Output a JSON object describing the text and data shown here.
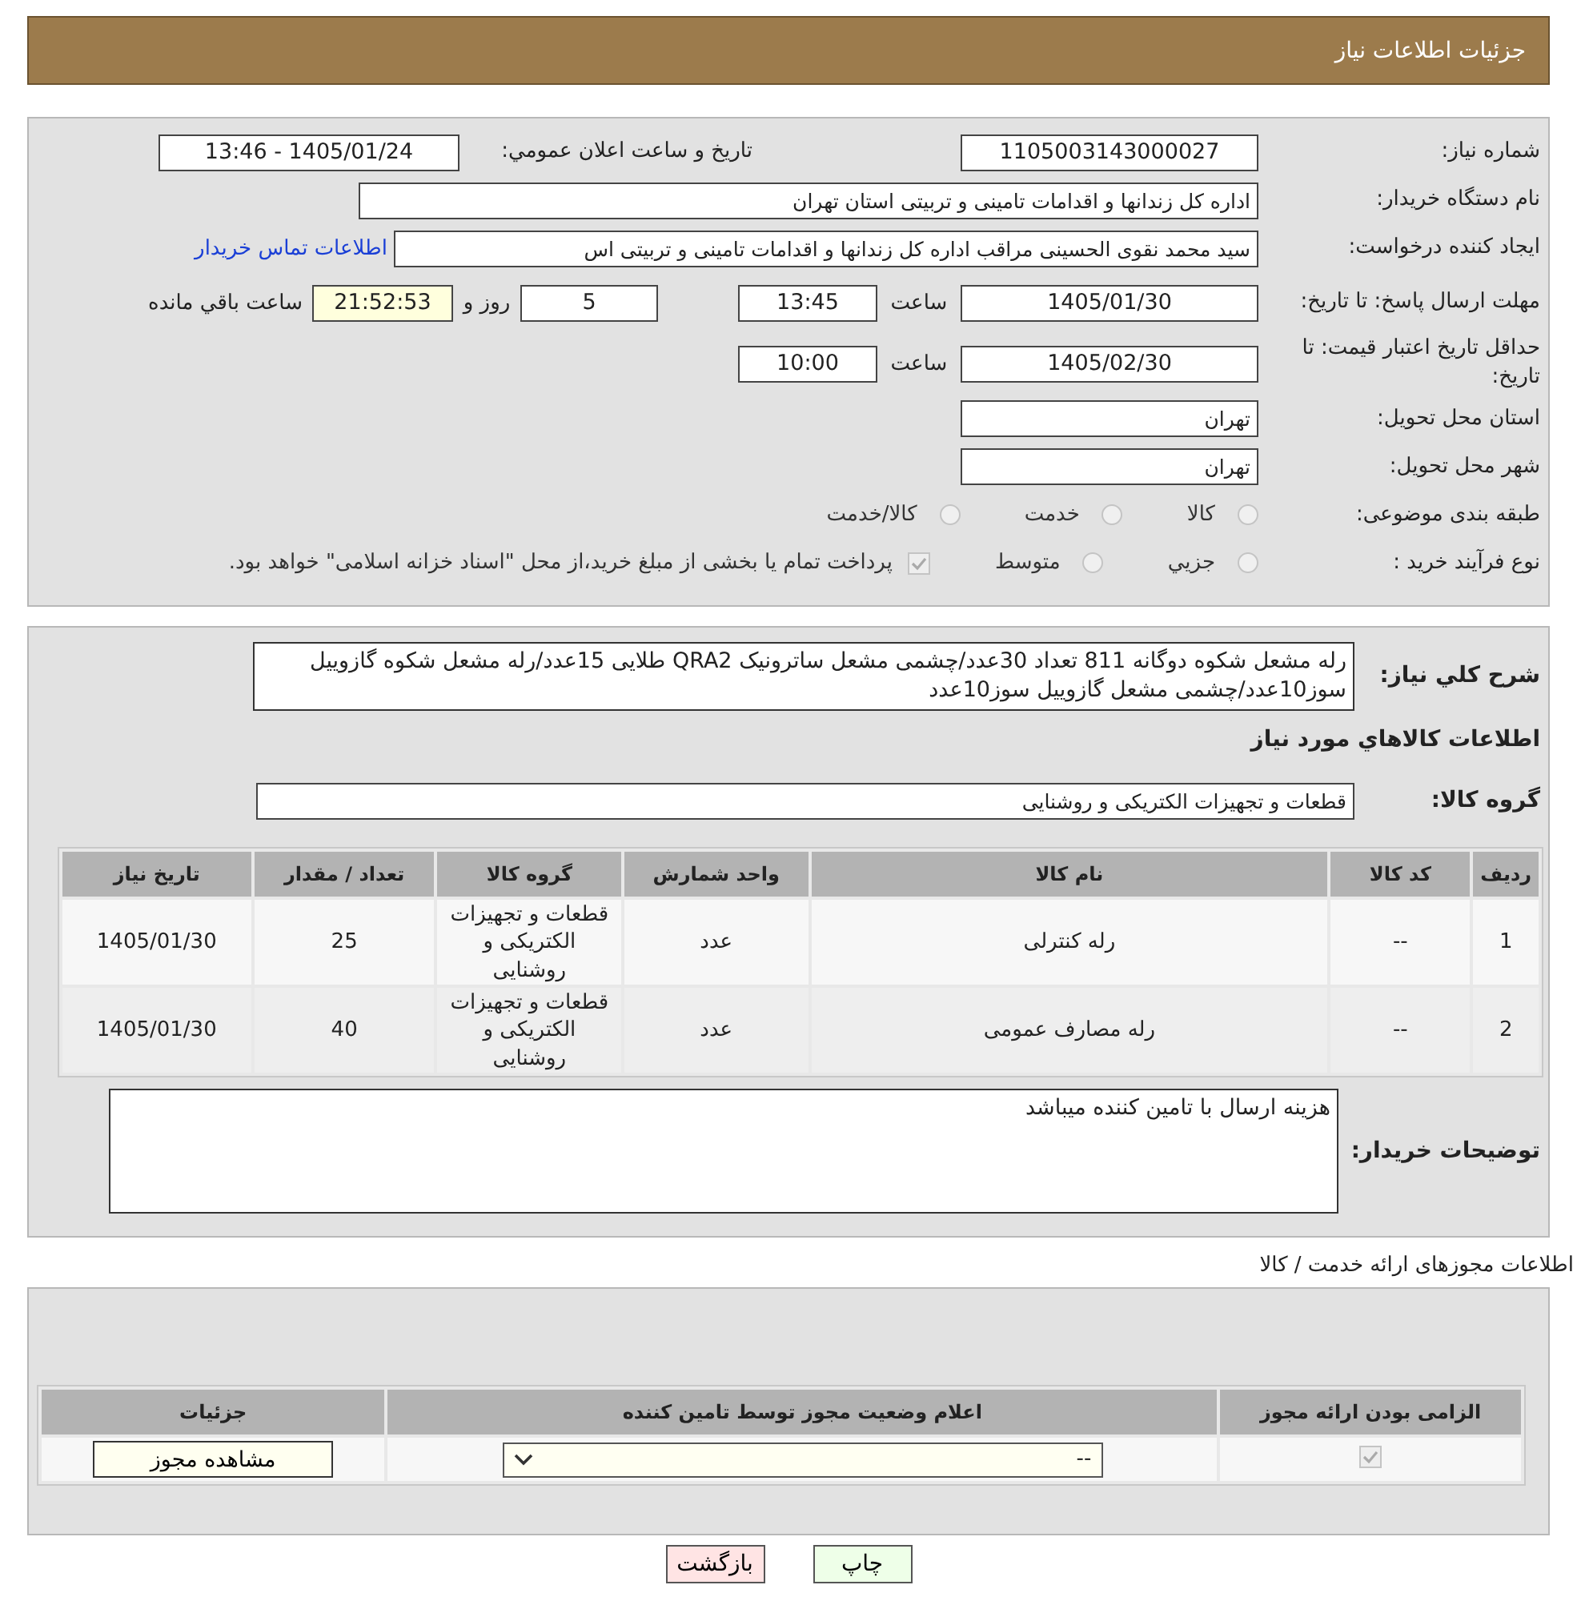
{
  "header": {
    "title": "جزئیات اطلاعات نیاز"
  },
  "info": {
    "need_number": {
      "label": "شماره نیاز:",
      "value": "1105003143000027"
    },
    "announce": {
      "label": "تاریخ و ساعت اعلان عمومي:",
      "value": "1405/01/24 - 13:46"
    },
    "buyer": {
      "label": "نام دستگاه خریدار:",
      "value": "اداره کل زندانها و اقدامات تامینی و تربیتی استان تهران"
    },
    "creator": {
      "label": "ایجاد کننده درخواست:",
      "value": "سید محمد نقوی الحسینی مراقب  اداره کل زندانها و اقدامات تامینی و تربیتی اس",
      "link": "اطلاعات تماس خریدار"
    },
    "reply_deadline": {
      "label": "مهلت ارسال پاسخ: تا تاریخ:",
      "date": "1405/01/30",
      "time_label": "ساعت",
      "time": "13:45",
      "days": "5",
      "days_label": "روز و",
      "remaining": "21:52:53",
      "remaining_label": "ساعت باقي مانده"
    },
    "price_validity": {
      "label": "حداقل تاریخ اعتبار قیمت: تا تاریخ:",
      "date": "1405/02/30",
      "time_label": "ساعت",
      "time": "10:00"
    },
    "province": {
      "label": "استان محل تحویل:",
      "value": "تهران"
    },
    "city": {
      "label": "شهر محل تحویل:",
      "value": "تهران"
    },
    "category": {
      "label": "طبقه بندی موضوعی:",
      "options": [
        {
          "label": "کالا",
          "selected": false
        },
        {
          "label": "خدمت",
          "selected": false
        },
        {
          "label": "کالا/خدمت",
          "selected": false
        }
      ]
    },
    "purchase_type": {
      "label": "نوع فرآیند خرید :",
      "options": [
        {
          "label": "جزيي",
          "selected": false
        },
        {
          "label": "متوسط",
          "selected": false
        }
      ],
      "payment": {
        "checked": true,
        "text": "پرداخت تمام یا بخشی از مبلغ خرید،از محل \"اسناد خزانه اسلامی\" خواهد بود."
      }
    }
  },
  "needs": {
    "description": {
      "label": "شرح کلي نیاز:",
      "value": "رله مشعل شکوه دوگانه 811 تعداد 30عدد/چشمی مشعل ساترونیک QRA2 طلایی 15عدد/رله مشعل شکوه گازوییل سوز10عدد/چشمی مشعل گازوییل سوز10عدد"
    },
    "goods_heading": "اطلاعات کالاهاي مورد نیاز",
    "goods_group": {
      "label": "گروه کالا:",
      "value": "قطعات و تجهیزات الکتریکی و روشنایی"
    },
    "table": {
      "columns": [
        "ردیف",
        "کد کالا",
        "نام کالا",
        "واحد شمارش",
        "گروه کالا",
        "تعداد / مقدار",
        "تاریخ نیاز"
      ],
      "rows": [
        [
          "1",
          "--",
          "رله کنترلی",
          "عدد",
          "قطعات و تجهیزات الکتریکی و روشنایی",
          "25",
          "1405/01/30"
        ],
        [
          "2",
          "--",
          "رله مصارف عمومی",
          "عدد",
          "قطعات و تجهیزات الکتریکی و روشنایی",
          "40",
          "1405/01/30"
        ]
      ]
    },
    "buyer_notes": {
      "label": "توضیحات خریدار:",
      "value": "هزینه ارسال با تامین کننده میباشد"
    }
  },
  "licenses": {
    "title": "اطلاعات مجوزهای ارائه خدمت / کالا",
    "columns": [
      "الزامی بودن ارائه مجوز",
      "اعلام وضعیت مجوز توسط تامین کننده",
      "جزئیات"
    ],
    "rows": [
      {
        "required": true,
        "status": "--",
        "details_button": "مشاهده مجوز"
      }
    ]
  },
  "buttons": [
    {
      "label": "چاپ",
      "color": "#eeffe8"
    },
    {
      "label": "بازگشت",
      "color": "#ffe4e4"
    }
  ]
}
